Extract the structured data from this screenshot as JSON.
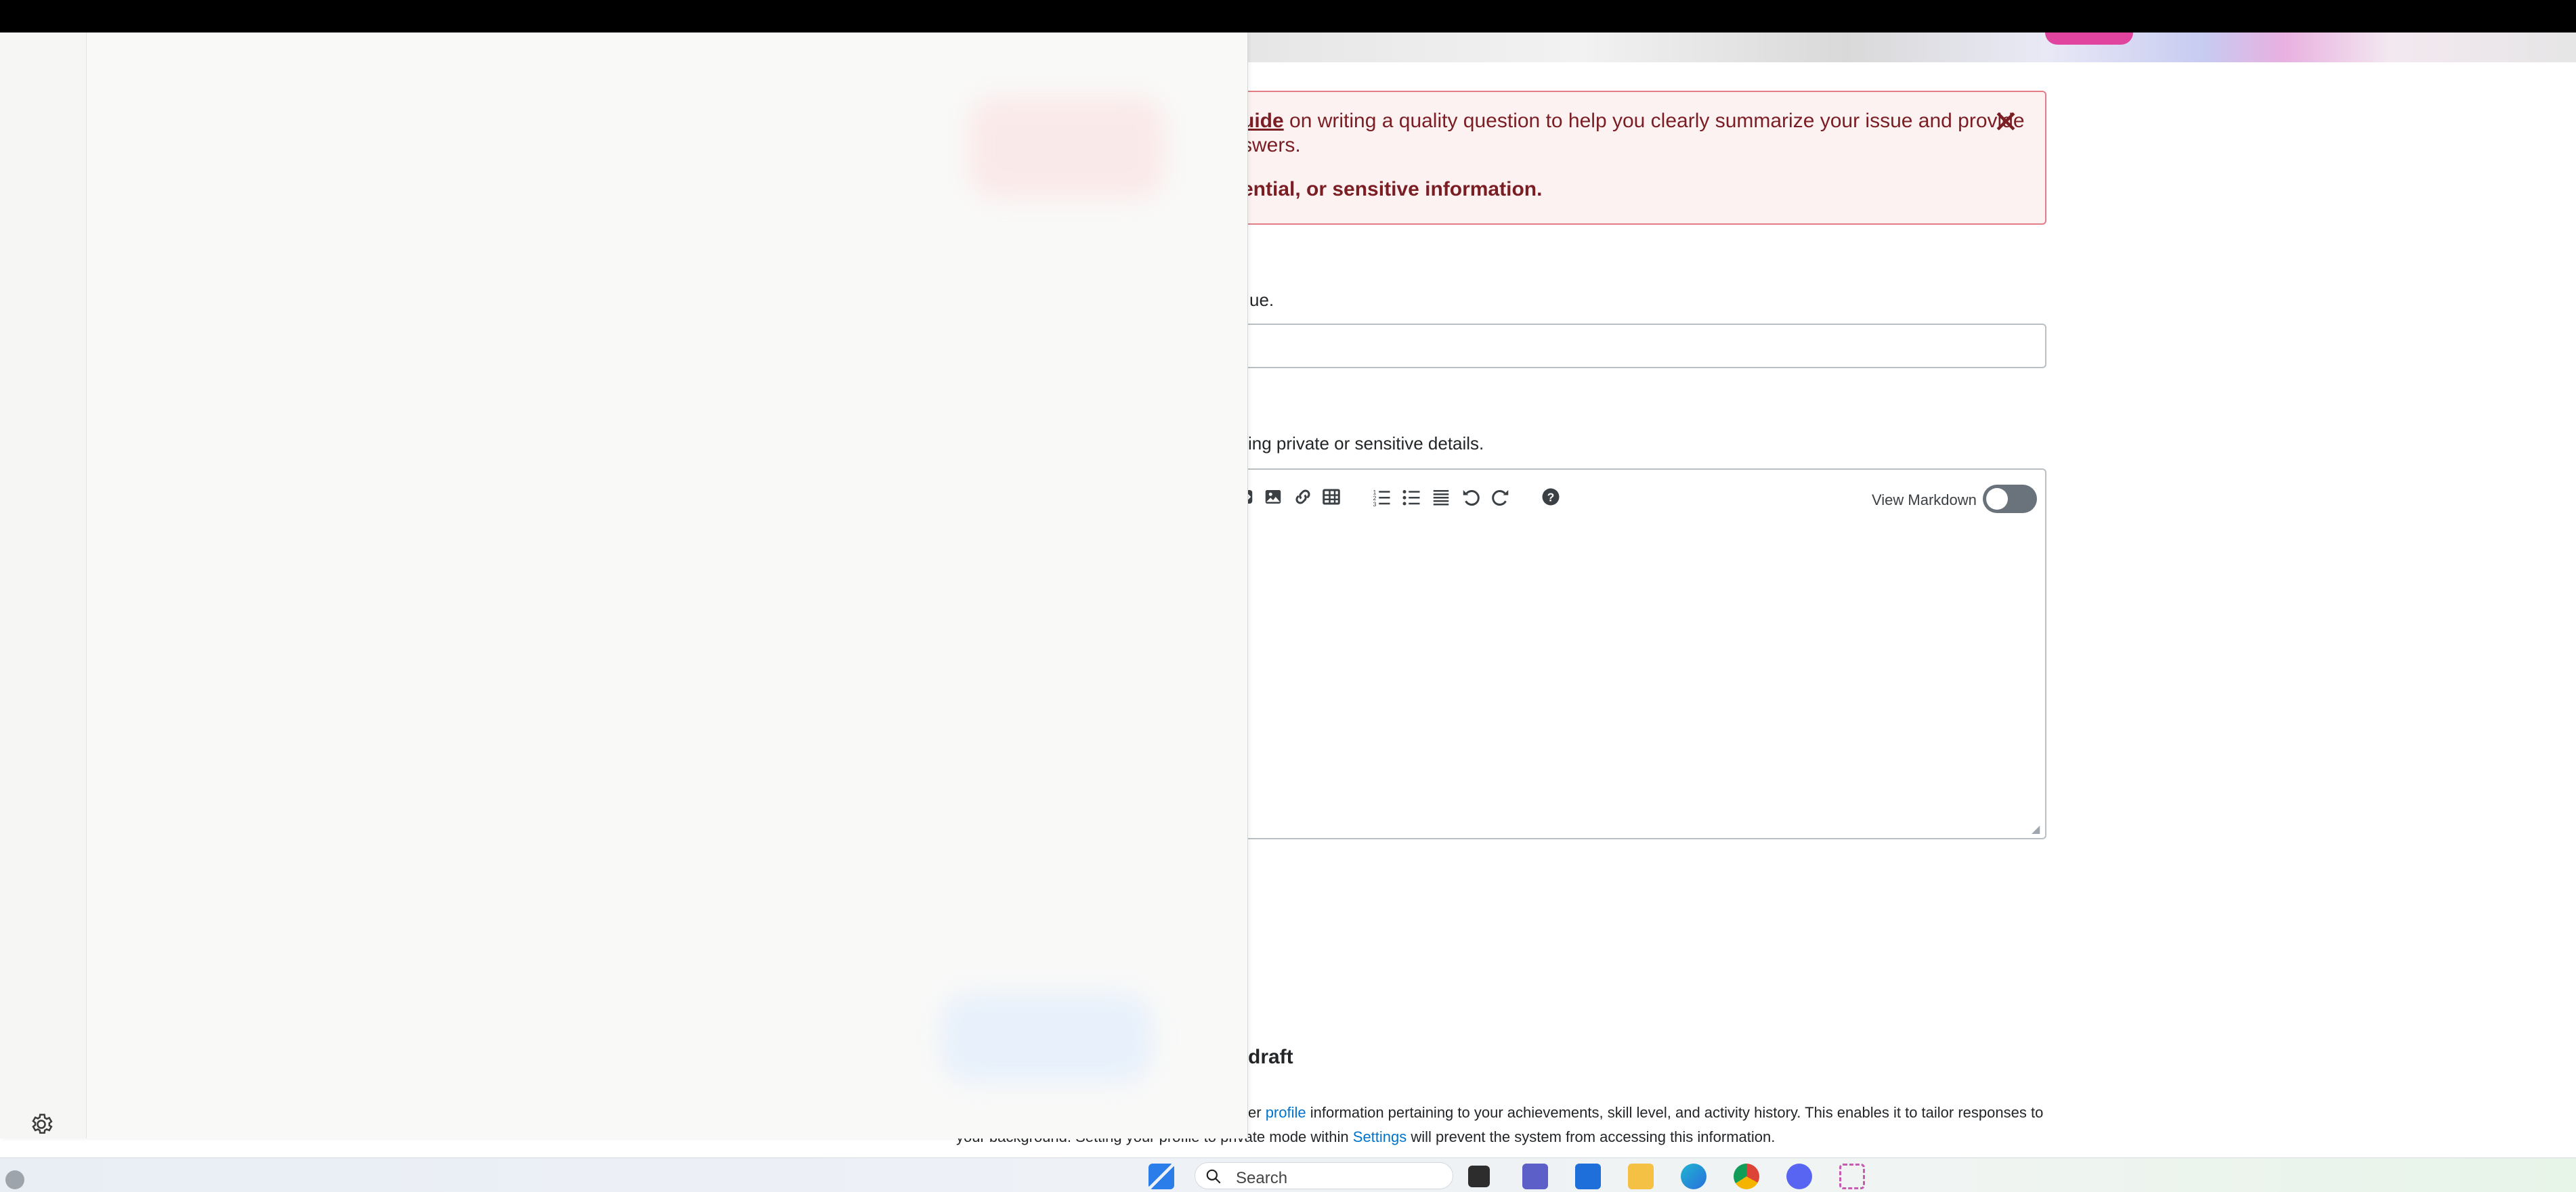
{
  "alert": {
    "guide_link": "uide",
    "line1_rest": " on writing a quality question to help you clearly summarize your issue and provide",
    "line2": "swers.",
    "line3": "ential, or sensitive information.",
    "close_glyph": "✕"
  },
  "title_section": {
    "help_text": "ue.",
    "input_value": ""
  },
  "body_section": {
    "help_text": "ing private or sensitive details."
  },
  "editor": {
    "view_markdown_label": "View Markdown",
    "markdown_toggle_on": false,
    "toolbar_icons": [
      "snippet-icon",
      "image-icon",
      "link-icon",
      "table-icon",
      "numbered-list-icon",
      "bulleted-list-icon",
      "horizontal-rule-icon",
      "undo-icon",
      "redo-icon",
      "help-icon"
    ]
  },
  "draft": {
    "heading": "draft",
    "note_line1_prefix": "er ",
    "profile_link": "profile",
    "note_line1_rest": " information pertaining to your achievements, skill level, and activity history. This enables it to tailor responses to",
    "note_line2_start": "your background. Setting your profile to private mode within ",
    "settings_link": "Settings",
    "note_line2_rest": " will prevent the system from accessing this information."
  },
  "taskbar": {
    "search_placeholder": "Search",
    "apps": [
      "windows-start-icon",
      "task-view-icon",
      "teams-icon",
      "store-icon",
      "file-explorer-icon",
      "edge-icon",
      "chrome-icon",
      "discord-icon",
      "snipping-tool-icon"
    ]
  },
  "colors": {
    "alert_text": "#7a1e24",
    "alert_bg": "#fdf2f2",
    "alert_border": "#e27d86",
    "link": "#0074cc",
    "side_panel_bg": "#f9f9f8"
  }
}
